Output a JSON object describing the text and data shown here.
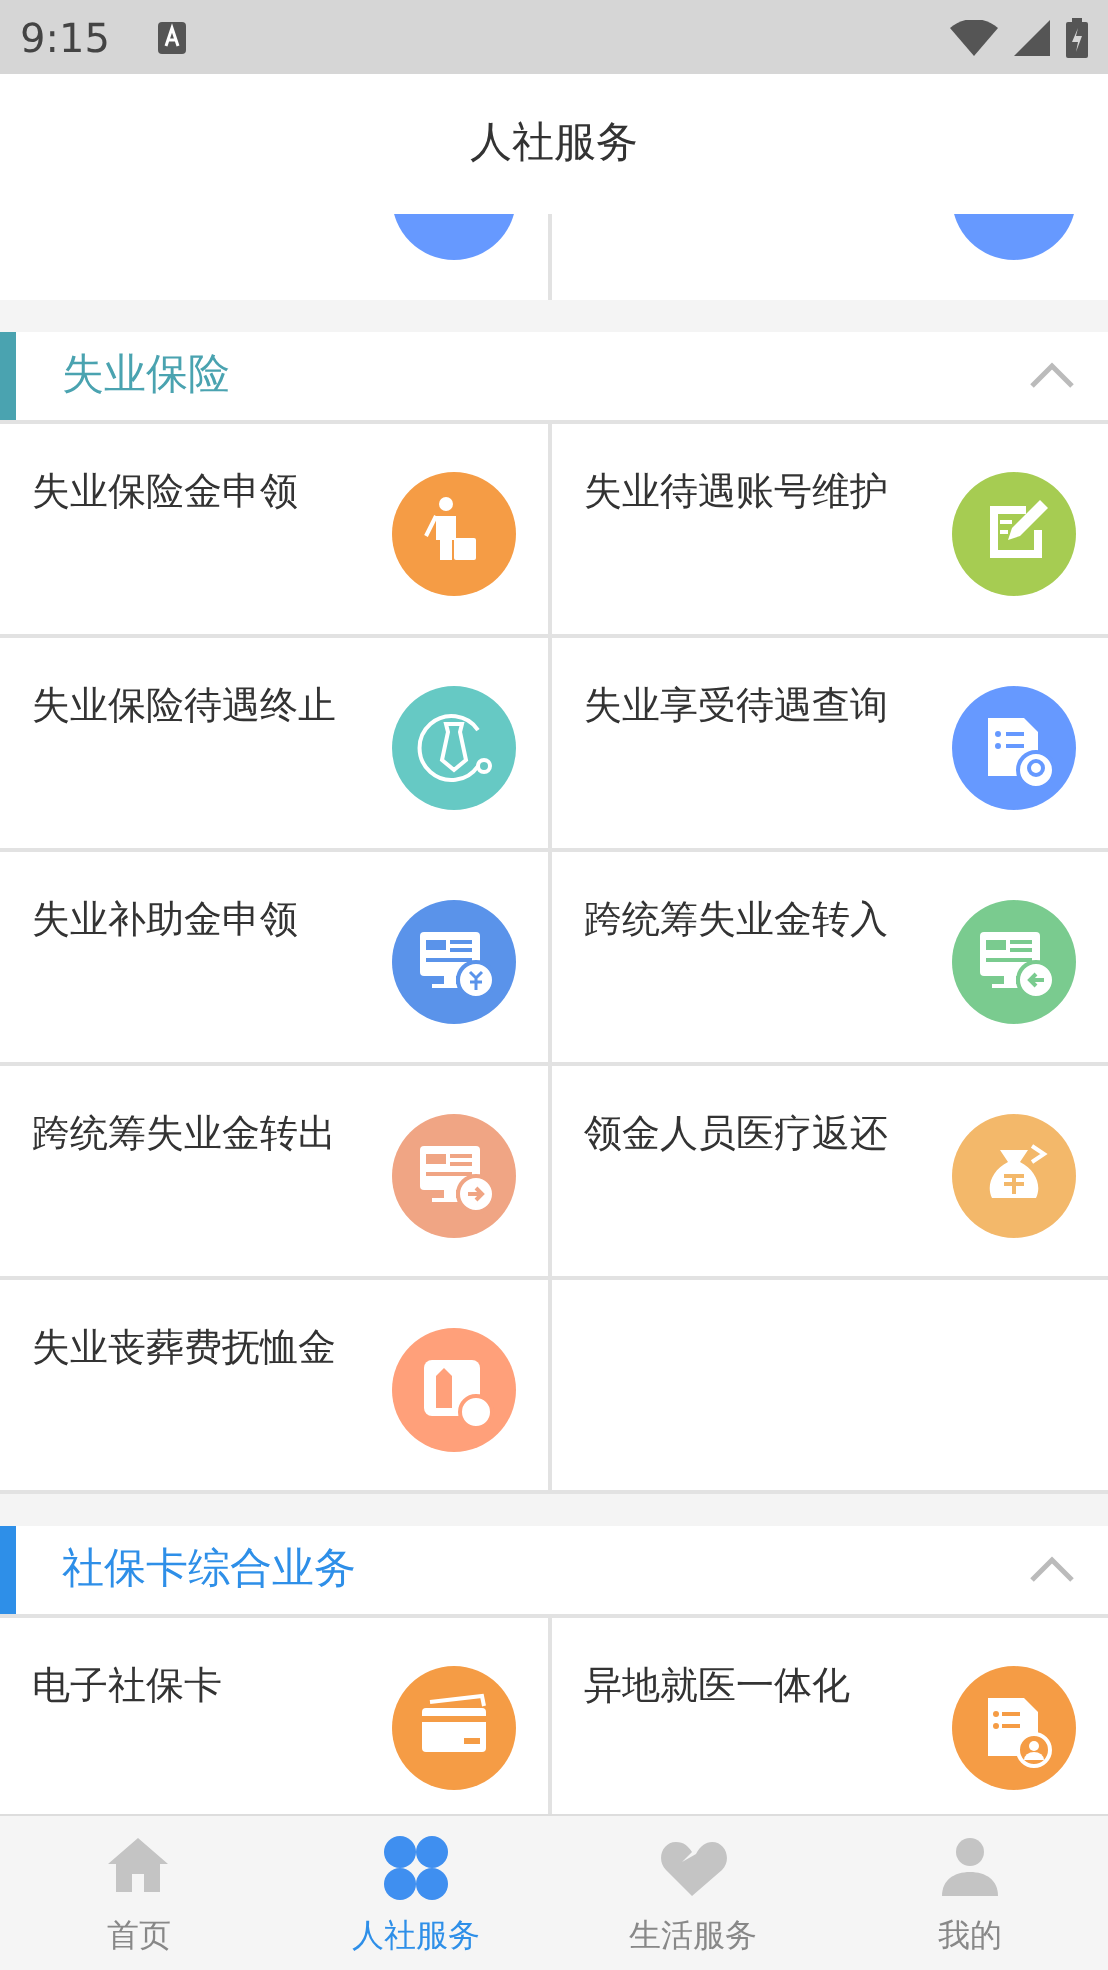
{
  "status_bar": {
    "time": "9:15"
  },
  "header": {
    "title": "人社服务"
  },
  "cut_row": [
    {
      "color": "#6699ff"
    },
    {
      "color": "#6699ff"
    }
  ],
  "sections": [
    {
      "title": "失业保险",
      "color": "#4aa3b0",
      "expanded": true,
      "items": [
        {
          "label": "失业保险金申领",
          "kind": "walker",
          "color": "#f59c45"
        },
        {
          "label": "失业待遇账号维护",
          "kind": "edit",
          "color": "#a6cc52"
        },
        {
          "label": "失业保险待遇终止",
          "kind": "tie",
          "color": "#66c9c4"
        },
        {
          "label": "失业享受待遇查询",
          "kind": "doc-search",
          "color": "#6699ff"
        },
        {
          "label": "失业补助金申领",
          "kind": "screen-yen",
          "color": "#5a93ea"
        },
        {
          "label": "跨统筹失业金转入",
          "kind": "screen-in",
          "color": "#7acb8f"
        },
        {
          "label": "跨统筹失业金转出",
          "kind": "screen-out",
          "color": "#f0a584"
        },
        {
          "label": "领金人员医疗返还",
          "kind": "bag",
          "color": "#f3b86a"
        },
        {
          "label": "失业丧葬费抚恤金",
          "kind": "stone",
          "color": "#ffa07a"
        }
      ]
    },
    {
      "title": "社保卡综合业务",
      "color": "#2e8fe8",
      "expanded": true,
      "items": [
        {
          "label": "电子社保卡",
          "kind": "card",
          "color": "#f59c45"
        },
        {
          "label": "异地就医一体化",
          "kind": "doc-person",
          "color": "#f59c45"
        }
      ]
    }
  ],
  "tabs": [
    {
      "label": "首页",
      "kind": "home",
      "selected": false
    },
    {
      "label": "人社服务",
      "kind": "clover",
      "selected": true
    },
    {
      "label": "生活服务",
      "kind": "heart",
      "selected": false
    },
    {
      "label": "我的",
      "kind": "person",
      "selected": false
    }
  ]
}
